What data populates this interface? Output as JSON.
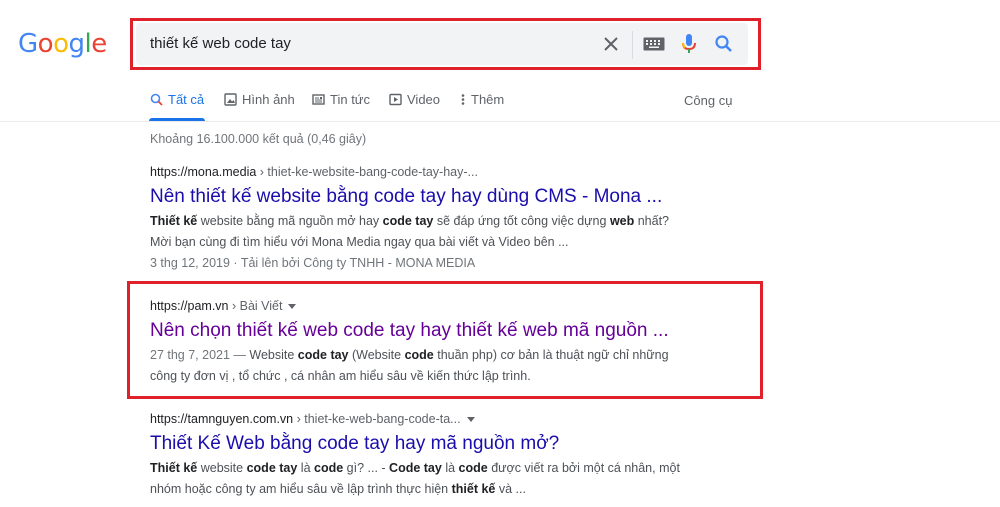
{
  "logo": {
    "letters": [
      "G",
      "o",
      "o",
      "g",
      "l",
      "e"
    ],
    "colors": [
      "#4285F4",
      "#EA4335",
      "#FBBC05",
      "#4285F4",
      "#34A853",
      "#EA4335"
    ]
  },
  "search": {
    "query": "thiết kế web code tay"
  },
  "tabs": [
    {
      "label": "Tất cả",
      "icon": "search-icon"
    },
    {
      "label": "Hình ảnh",
      "icon": "image-icon"
    },
    {
      "label": "Tin tức",
      "icon": "news-icon"
    },
    {
      "label": "Video",
      "icon": "video-icon"
    },
    {
      "label": "Thêm",
      "icon": "more-icon"
    }
  ],
  "tools_label": "Công cụ",
  "stats": "Khoảng 16.100.000 kết quả (0,46 giây)",
  "results": [
    {
      "domain": "https://mona.media",
      "path": " › thiet-ke-website-bang-code-tay-hay-...",
      "title": "Nên thiết kế website bằng code tay hay dùng CMS - Mona ...",
      "snippet1_a": "Thiết kế",
      "snippet1_b": " website bằng mã nguồn mở hay ",
      "snippet1_c": "code tay",
      "snippet1_d": " sẽ đáp ứng tốt công việc dựng ",
      "snippet1_e": "web",
      "snippet1_f": " nhất?",
      "snippet2": "Mời bạn cùng đi tìm hiểu với Mona Media ngay qua bài viết và Video bên ...",
      "meta": "3 thg 12, 2019 · Tải lên bởi Công ty TNHH - MONA MEDIA"
    },
    {
      "domain": "https://pam.vn",
      "path": " › Bài Viết",
      "title": "Nên chọn thiết kế web code tay hay thiết kế web mã nguồn ...",
      "date": "27 thg 7, 2021 — ",
      "snippet1_a": "Website ",
      "snippet1_b": "code tay",
      "snippet1_c": " (Website ",
      "snippet1_d": "code",
      "snippet1_e": " thuần php) cơ bản là thuật ngữ chỉ những",
      "snippet2": "công ty đơn vị , tổ chức , cá nhân am hiểu sâu về kiến thức lập trình."
    },
    {
      "domain": "https://tamnguyen.com.vn",
      "path": " › thiet-ke-web-bang-code-ta...",
      "title": "Thiết Kế Web bằng code tay hay mã nguồn mở?",
      "snippet1_a": "Thiết kế",
      "snippet1_b": " website ",
      "snippet1_c": "code tay",
      "snippet1_d": " là ",
      "snippet1_e": "code",
      "snippet1_f": " gì? ... - ",
      "snippet1_g": "Code tay",
      "snippet1_h": " là ",
      "snippet1_i": "code",
      "snippet1_j": " được viết ra bởi một cá nhân, một",
      "snippet2_a": "nhóm hoặc công ty am hiểu sâu về lập trình thực hiện ",
      "snippet2_b": "thiết kế",
      "snippet2_c": " và ..."
    }
  ]
}
